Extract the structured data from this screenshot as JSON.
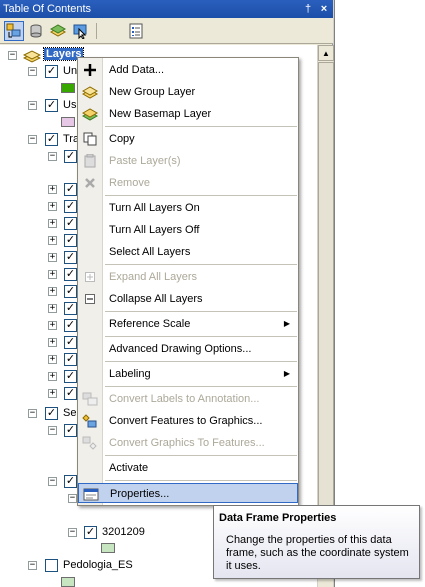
{
  "window": {
    "title": "Table Of Contents",
    "pin_glyph": "†",
    "close_glyph": "×"
  },
  "toolbar": {
    "buttons": [
      {
        "name": "list-by-drawing-order-icon"
      },
      {
        "name": "list-by-source-icon"
      },
      {
        "name": "list-by-visibility-icon"
      },
      {
        "name": "list-by-selection-icon"
      },
      {
        "name": "options-icon"
      }
    ]
  },
  "tree": {
    "root_label": "Layers",
    "labels": {
      "un": "Un",
      "us": "Us",
      "tra": "Tra",
      "se": "Se",
      "layer_3201209": "3201209",
      "pedologia": "Pedologia_ES"
    },
    "colors": {
      "un_swatch": "#38a800",
      "us_swatch": "#e6c8e6",
      "pedologia_swatch": "#c7e5c0"
    }
  },
  "context_menu": {
    "items": [
      {
        "label": "Add Data...",
        "enabled": true,
        "icon": "add-data-icon"
      },
      {
        "label": "New Group Layer",
        "enabled": true,
        "icon": "group-layer-icon"
      },
      {
        "label": "New Basemap Layer",
        "enabled": true,
        "icon": "basemap-layer-icon"
      },
      {
        "label": "Copy",
        "enabled": true,
        "icon": "copy-icon"
      },
      {
        "label": "Paste Layer(s)",
        "enabled": false,
        "icon": "paste-icon"
      },
      {
        "label": "Remove",
        "enabled": false,
        "icon": "remove-icon"
      },
      {
        "label": "Turn All Layers On",
        "enabled": true
      },
      {
        "label": "Turn All Layers Off",
        "enabled": true
      },
      {
        "label": "Select All Layers",
        "enabled": true
      },
      {
        "label": "Expand All Layers",
        "enabled": false,
        "icon": "expand-icon"
      },
      {
        "label": "Collapse All Layers",
        "enabled": true,
        "icon": "collapse-icon"
      },
      {
        "label": "Reference Scale",
        "enabled": true,
        "submenu": true
      },
      {
        "label": "Advanced Drawing Options...",
        "enabled": true
      },
      {
        "label": "Labeling",
        "enabled": true,
        "submenu": true
      },
      {
        "label": "Convert Labels to Annotation...",
        "enabled": false,
        "icon": "convert-labels-icon"
      },
      {
        "label": "Convert Features to Graphics...",
        "enabled": true,
        "icon": "convert-features-icon"
      },
      {
        "label": "Convert Graphics To Features...",
        "enabled": false,
        "icon": "convert-graphics-icon"
      },
      {
        "label": "Activate",
        "enabled": true
      },
      {
        "label": "Properties...",
        "enabled": true,
        "icon": "properties-icon",
        "highlighted": true
      }
    ]
  },
  "tooltip": {
    "title": "Data Frame Properties",
    "body": "Change the properties of this data frame, such as the coordinate system it uses."
  }
}
